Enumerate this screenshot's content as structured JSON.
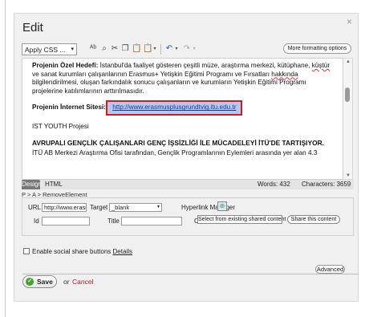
{
  "dialog": {
    "title": "Edit",
    "close_symbol": "×"
  },
  "toolbar": {
    "style_select": "Apply CSS ...",
    "icons": [
      "spellcheck-icon",
      "find-icon",
      "cut-icon",
      "copy-icon",
      "paste-icon",
      "paste-special-icon",
      "undo-icon",
      "redo-icon"
    ],
    "more_formatting_label": "More formatting options"
  },
  "editor": {
    "para1_bold": "Projenin Özel Hedefi:",
    "para1_text_a": " İstanbul'da faaliyet gösteren çeşitli müze, araştırma merkezi, kütüphane, ",
    "para1_word_kustur": "küştür",
    "para1_text_b": " ve sanat kurumları çalışanlarının Erasmus+ Yetişkin Eğitimi Programı ve Fırsatları ",
    "para1_word_hakkinda": "hakkında",
    "para1_text_c": " bilgilendirilmesi, oluşan farkındalık sonucu çalışanların ve kurumların Yetişkin Eğitimi Programı projelerine katılımlarının arttırılmasıdır.",
    "para2_label": "Projenin İnternet Sitesi:",
    "para2_link": "http://www.erasmusplusgrundtvig.itu.edu.tr",
    "para3_text": "IST YOUTH Projesi",
    "heading": "AVRUPALI GENÇLİK ÇALIŞANLARI GENÇ İŞSİZLİĞİ İLE MÜCADELEYİ İTÜ'DE TARTIŞIYOR.",
    "para4_text": "İTÜ AB Merkezi Araştırma Ofisi tarafından,  Gençlik Programlarının Eylemleri arasında yer alan 4.3"
  },
  "status": {
    "tab_design": "Design",
    "tab_html": "HTML",
    "words": "Words: 432",
    "characters": "Characters: 3659"
  },
  "breadcrumb": "P > A > RemoveElement",
  "link_props": {
    "url_label": "URL",
    "url_value": "http://www.erasmu",
    "target_label": "Target",
    "target_value": "_blank",
    "hyperlink_manager_label": "Hyperlink Manager",
    "id_label": "Id",
    "id_value": "",
    "title_label": "Title",
    "title_value": "",
    "css_label": "Cla",
    "select_shared_label": "Select from existing shared content",
    "share_content_label": "Share this content"
  },
  "social": {
    "label": "Enable social share buttons",
    "details_link": "Details",
    "checked": false
  },
  "footer": {
    "advanced_label": "Advanced",
    "save_label": "Save",
    "or_text": "or",
    "cancel_label": "Cancel"
  },
  "colors": {
    "accent_green": "#45a22d",
    "cancel_red": "#c0181f",
    "highlight_border": "#d11c1c",
    "link_blue": "#1a39a8"
  }
}
